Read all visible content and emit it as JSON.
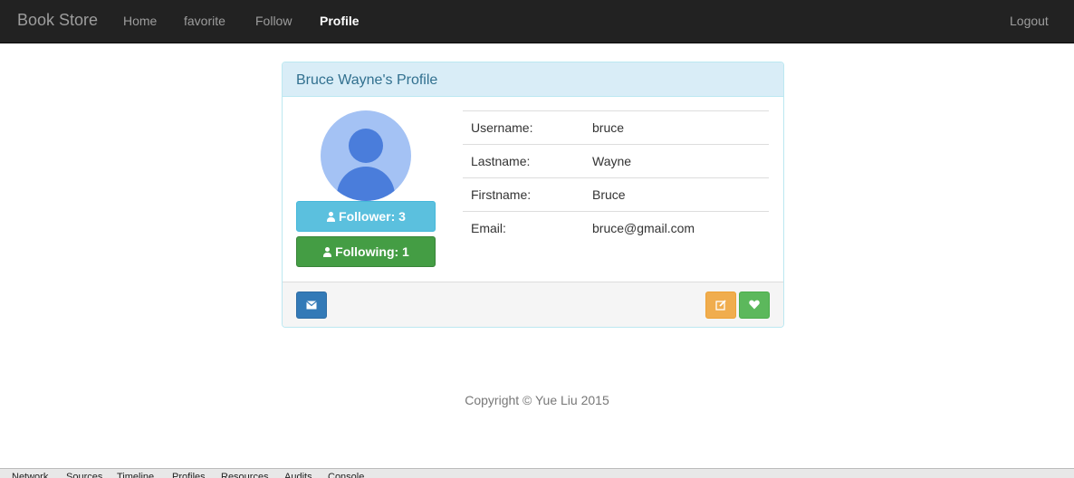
{
  "navbar": {
    "brand": "Book Store",
    "links": [
      {
        "label": "Home"
      },
      {
        "label": "favorite"
      },
      {
        "label": "Follow"
      },
      {
        "label": "Profile",
        "active": true
      }
    ],
    "logout": "Logout"
  },
  "panel": {
    "title": "Bruce Wayne's Profile",
    "avatar_icon": "user-avatar-icon",
    "follower_label": "Follower: 3",
    "following_label": "Following: 1",
    "rows": [
      {
        "key": "Username:",
        "value": "bruce"
      },
      {
        "key": "Lastname:",
        "value": "Wayne"
      },
      {
        "key": "Firstname:",
        "value": "Bruce"
      },
      {
        "key": "Email:",
        "value": "bruce@gmail.com"
      }
    ],
    "footer_icons": {
      "message": "envelope-icon",
      "edit": "edit-icon",
      "favorite": "heart-icon"
    }
  },
  "footer": {
    "copyright": "Copyright © Yue Liu 2015"
  },
  "devtools": {
    "tabs": [
      "Network",
      "Sources",
      "Timeline",
      "Profiles",
      "Resources",
      "Audits",
      "Console"
    ]
  },
  "colors": {
    "navbar_bg": "#222222",
    "panel_heading_bg": "#d9edf7",
    "info_btn": "#5bc0de",
    "success_btn": "#449d44",
    "primary_btn": "#337ab7",
    "warning_btn": "#f0ad4e"
  }
}
